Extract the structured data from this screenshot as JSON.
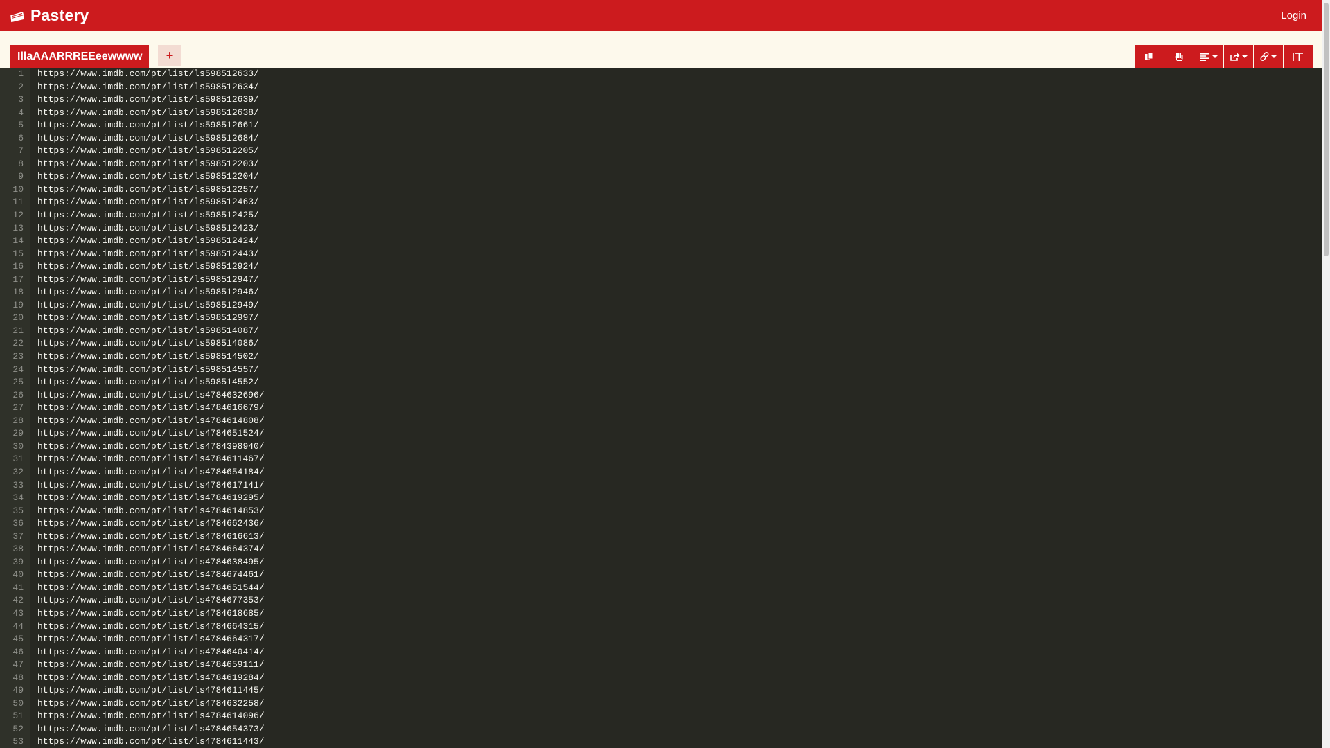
{
  "app": {
    "name": "Pastery",
    "login_label": "Login",
    "brand_color": "#cc1b1e",
    "brand_icon": "cake-slice-icon"
  },
  "tabs": {
    "active_title": "IllaAAARRREEeewwww",
    "add_label": "+"
  },
  "toolbar": {
    "buttons": [
      {
        "name": "copy-button",
        "icon": "copy-icon"
      },
      {
        "name": "hand-button",
        "icon": "hand-icon"
      },
      {
        "name": "align-dropdown-button",
        "icon": "align-left-icon"
      },
      {
        "name": "share-dropdown-button",
        "icon": "share-icon"
      },
      {
        "name": "link-dropdown-button",
        "icon": "link-icon"
      },
      {
        "name": "text-size-button",
        "icon": "text-height-icon"
      }
    ]
  },
  "editor": {
    "background": "#272822",
    "text_color": "#f8f8f2",
    "lines": [
      {
        "n": "1",
        "text": "https://www.imdb.com/pt/list/ls598512633/"
      },
      {
        "n": "2",
        "text": "https://www.imdb.com/pt/list/ls598512634/"
      },
      {
        "n": "3",
        "text": "https://www.imdb.com/pt/list/ls598512639/"
      },
      {
        "n": "4",
        "text": "https://www.imdb.com/pt/list/ls598512638/"
      },
      {
        "n": "5",
        "text": "https://www.imdb.com/pt/list/ls598512661/"
      },
      {
        "n": "6",
        "text": "https://www.imdb.com/pt/list/ls598512684/"
      },
      {
        "n": "7",
        "text": "https://www.imdb.com/pt/list/ls598512205/"
      },
      {
        "n": "8",
        "text": "https://www.imdb.com/pt/list/ls598512203/"
      },
      {
        "n": "9",
        "text": "https://www.imdb.com/pt/list/ls598512204/"
      },
      {
        "n": "10",
        "text": "https://www.imdb.com/pt/list/ls598512257/"
      },
      {
        "n": "11",
        "text": "https://www.imdb.com/pt/list/ls598512463/"
      },
      {
        "n": "12",
        "text": "https://www.imdb.com/pt/list/ls598512425/"
      },
      {
        "n": "13",
        "text": "https://www.imdb.com/pt/list/ls598512423/"
      },
      {
        "n": "14",
        "text": "https://www.imdb.com/pt/list/ls598512424/"
      },
      {
        "n": "15",
        "text": "https://www.imdb.com/pt/list/ls598512443/"
      },
      {
        "n": "16",
        "text": "https://www.imdb.com/pt/list/ls598512924/"
      },
      {
        "n": "17",
        "text": "https://www.imdb.com/pt/list/ls598512947/"
      },
      {
        "n": "18",
        "text": "https://www.imdb.com/pt/list/ls598512946/"
      },
      {
        "n": "19",
        "text": "https://www.imdb.com/pt/list/ls598512949/"
      },
      {
        "n": "20",
        "text": "https://www.imdb.com/pt/list/ls598512997/"
      },
      {
        "n": "21",
        "text": "https://www.imdb.com/pt/list/ls598514087/"
      },
      {
        "n": "22",
        "text": "https://www.imdb.com/pt/list/ls598514086/"
      },
      {
        "n": "23",
        "text": "https://www.imdb.com/pt/list/ls598514502/"
      },
      {
        "n": "24",
        "text": "https://www.imdb.com/pt/list/ls598514557/"
      },
      {
        "n": "25",
        "text": "https://www.imdb.com/pt/list/ls598514552/"
      },
      {
        "n": "26",
        "text": "https://www.imdb.com/pt/list/ls4784632696/"
      },
      {
        "n": "27",
        "text": "https://www.imdb.com/pt/list/ls4784616679/"
      },
      {
        "n": "28",
        "text": "https://www.imdb.com/pt/list/ls4784614808/"
      },
      {
        "n": "29",
        "text": "https://www.imdb.com/pt/list/ls4784651524/"
      },
      {
        "n": "30",
        "text": "https://www.imdb.com/pt/list/ls4784398940/"
      },
      {
        "n": "31",
        "text": "https://www.imdb.com/pt/list/ls4784611467/"
      },
      {
        "n": "32",
        "text": "https://www.imdb.com/pt/list/ls4784654184/"
      },
      {
        "n": "33",
        "text": "https://www.imdb.com/pt/list/ls4784617141/"
      },
      {
        "n": "34",
        "text": "https://www.imdb.com/pt/list/ls4784619295/"
      },
      {
        "n": "35",
        "text": "https://www.imdb.com/pt/list/ls4784614853/"
      },
      {
        "n": "36",
        "text": "https://www.imdb.com/pt/list/ls4784662436/"
      },
      {
        "n": "37",
        "text": "https://www.imdb.com/pt/list/ls4784616613/"
      },
      {
        "n": "38",
        "text": "https://www.imdb.com/pt/list/ls4784664374/"
      },
      {
        "n": "39",
        "text": "https://www.imdb.com/pt/list/ls4784638495/"
      },
      {
        "n": "40",
        "text": "https://www.imdb.com/pt/list/ls4784674461/"
      },
      {
        "n": "41",
        "text": "https://www.imdb.com/pt/list/ls4784651544/"
      },
      {
        "n": "42",
        "text": "https://www.imdb.com/pt/list/ls4784677353/"
      },
      {
        "n": "43",
        "text": "https://www.imdb.com/pt/list/ls4784618685/"
      },
      {
        "n": "44",
        "text": "https://www.imdb.com/pt/list/ls4784664315/"
      },
      {
        "n": "45",
        "text": "https://www.imdb.com/pt/list/ls4784664317/"
      },
      {
        "n": "46",
        "text": "https://www.imdb.com/pt/list/ls4784640414/"
      },
      {
        "n": "47",
        "text": "https://www.imdb.com/pt/list/ls4784659111/"
      },
      {
        "n": "48",
        "text": "https://www.imdb.com/pt/list/ls4784619284/"
      },
      {
        "n": "49",
        "text": "https://www.imdb.com/pt/list/ls4784611445/"
      },
      {
        "n": "50",
        "text": "https://www.imdb.com/pt/list/ls4784632258/"
      },
      {
        "n": "51",
        "text": "https://www.imdb.com/pt/list/ls4784614096/"
      },
      {
        "n": "52",
        "text": "https://www.imdb.com/pt/list/ls4784654373/"
      },
      {
        "n": "53",
        "text": "https://www.imdb.com/pt/list/ls4784611443/"
      }
    ]
  }
}
